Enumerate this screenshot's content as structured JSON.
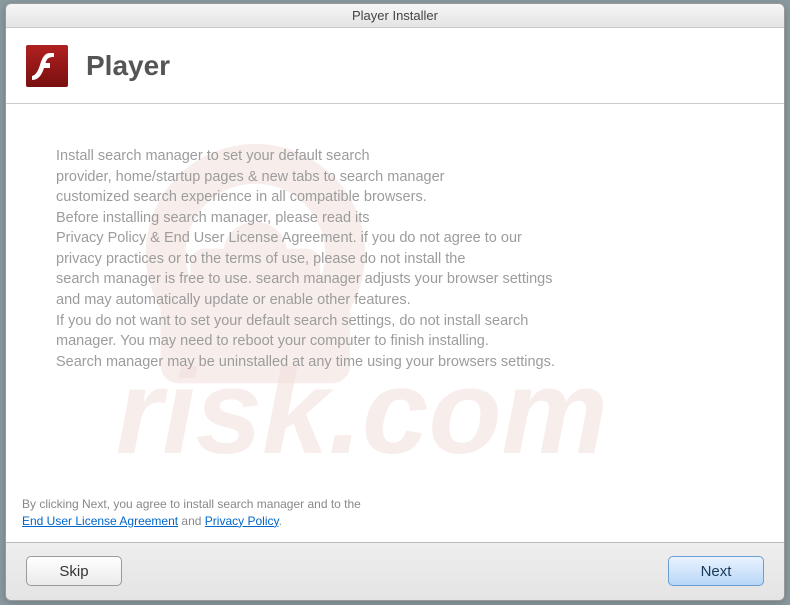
{
  "window": {
    "title": "Player Installer"
  },
  "header": {
    "app_title": "Player"
  },
  "body": {
    "text": "Install search manager to set your default search\nprovider, home/startup pages & new tabs to search manager\ncustomized search experience in all compatible browsers.\nBefore installing search manager, please read its\nPrivacy Policy & End User License Agreement. if you do not agree to our\nprivacy practices or to the terms of use, please do not install the\nsearch manager is free to use. search manager adjusts your browser settings\nand may automatically update or enable other features.\nIf you do not want to set your default search settings, do not install search\nmanager. You may need to reboot your computer to finish installing.\nSearch manager may be uninstalled at any time using your browsers settings."
  },
  "footer": {
    "consent_prefix": "By clicking Next, you agree to install search manager and to the",
    "eula_label": "End User License Agreement",
    "and": " and ",
    "privacy_label": "Privacy Policy",
    "period": "."
  },
  "buttons": {
    "skip_label": "Skip",
    "next_label": "Next"
  }
}
